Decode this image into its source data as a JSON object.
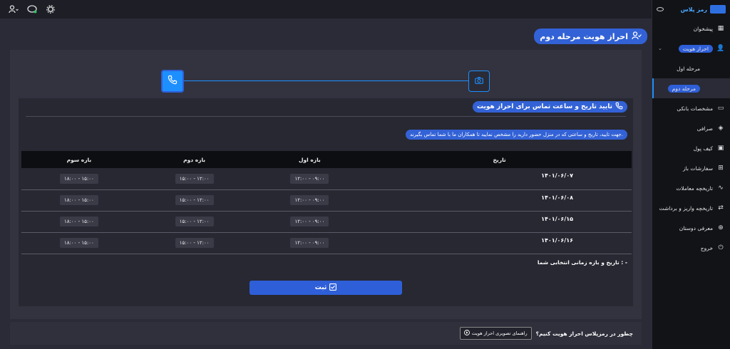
{
  "page": {
    "title": "احراز هویت مرحله دوم"
  },
  "sidebar": {
    "logo": "رمز پلاس",
    "items": [
      {
        "label": "پیشخوان",
        "icon": "dashboard-icon"
      },
      {
        "label": "احراز هویت",
        "icon": "user-check-icon"
      },
      {
        "label": "مرحله اول"
      },
      {
        "label": "مرحله دوم"
      },
      {
        "label": "مشخصات بانکی",
        "icon": "card-icon"
      },
      {
        "label": "صرافی",
        "icon": "exchange-icon"
      },
      {
        "label": "کیف پول",
        "icon": "wallet-icon"
      },
      {
        "label": "سفارشات باز",
        "icon": "cart-icon"
      },
      {
        "label": "تاریخچه معاملات",
        "icon": "chart-icon"
      },
      {
        "label": "تاریخچه واریز و برداشت",
        "icon": "transfer-icon"
      },
      {
        "label": "معرفی دوستان",
        "icon": "invite-icon"
      },
      {
        "label": "خروج",
        "icon": "power-icon"
      }
    ]
  },
  "section": {
    "title": "تایید تاریخ و ساعت تماس برای احراز هویت",
    "instruction": "جهت تایید، تاریخ و ساعتی که در منزل حضور دارید را مشخص نمایید تا همکاران ما با شما تماس بگیرند."
  },
  "table": {
    "headers": [
      "تاریخ",
      "بازه اول",
      "بازه دوم",
      "بازه سوم"
    ],
    "rows": [
      {
        "date": "۱۴۰۱/۰۶/۰۷",
        "slot1": "۰۹:۰۰ - ۱۲:۰۰",
        "slot2": "۱۲:۰۰ - ۱۵:۰۰",
        "slot3": "۱۵:۰۰ - ۱۸:۰۰"
      },
      {
        "date": "۱۴۰۱/۰۶/۰۸",
        "slot1": "۰۹:۰۰ - ۱۲:۰۰",
        "slot2": "۱۲:۰۰ - ۱۵:۰۰",
        "slot3": "۱۵:۰۰ - ۱۸:۰۰"
      },
      {
        "date": "۱۴۰۱/۰۶/۱۵",
        "slot1": "۰۹:۰۰ - ۱۲:۰۰",
        "slot2": "۱۲:۰۰ - ۱۵:۰۰",
        "slot3": "۱۵:۰۰ - ۱۸:۰۰"
      },
      {
        "date": "۱۴۰۱/۰۶/۱۶",
        "slot1": "۰۹:۰۰ - ۱۲:۰۰",
        "slot2": "۱۲:۰۰ - ۱۵:۰۰",
        "slot3": "۱۵:۰۰ - ۱۸:۰۰"
      }
    ]
  },
  "selected_label": "تاریخ و بازه زمانی انتخابی شما : -",
  "submit_label": "ثبت",
  "footer": {
    "question": "چطور در رمزپلاس احراز هویت کنیم؟",
    "guide_button": "راهنمای تصویری احراز هویت"
  },
  "colors": {
    "accent": "#1e8fff",
    "highlight": "#3362d6",
    "background": "#2a2b36"
  }
}
